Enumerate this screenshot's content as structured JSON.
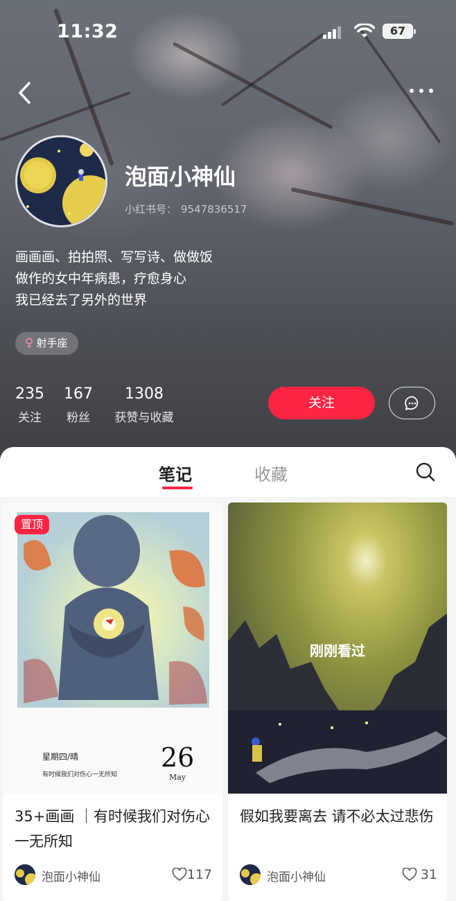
{
  "status": {
    "time": "11:32",
    "battery": "67"
  },
  "profile": {
    "nickname": "泡面小神仙",
    "id_label": "小红书号：",
    "id_value": "9547836517",
    "bio": [
      "画画画、拍拍照、写写诗、做做饭",
      "做作的女中年病患，疗愈身心",
      "我已经去了另外的世界"
    ],
    "tag_icon": "♀",
    "tag": "射手座"
  },
  "stats": [
    {
      "value": "235",
      "label": "关注"
    },
    {
      "value": "167",
      "label": "粉丝"
    },
    {
      "value": "1308",
      "label": "获赞与收藏"
    }
  ],
  "actions": {
    "follow": "关注"
  },
  "tabs": {
    "notes": "笔记",
    "favorites": "收藏"
  },
  "cards": [
    {
      "badge": "置顶",
      "diary_weekday": "星期四/晴",
      "diary_line": "有时候我们对伤心一无所知",
      "diary_day": "26",
      "diary_month": "May",
      "title": "35+画画 ｜有时候我们对伤心一无所知",
      "author": "泡面小神仙",
      "likes": "117"
    },
    {
      "overlay": "刚刚看过",
      "title": "假如我要离去 请不必太过悲伤",
      "author": "泡面小神仙",
      "likes": "31"
    }
  ],
  "colors": {
    "accent": "#ff2442",
    "text": "#222222",
    "muted": "#999999"
  },
  "icons": [
    "back-arrow-icon",
    "more-dots-icon",
    "message-icon",
    "search-icon",
    "heart-icon",
    "signal-icon",
    "wifi-icon",
    "battery-icon",
    "female-icon"
  ]
}
